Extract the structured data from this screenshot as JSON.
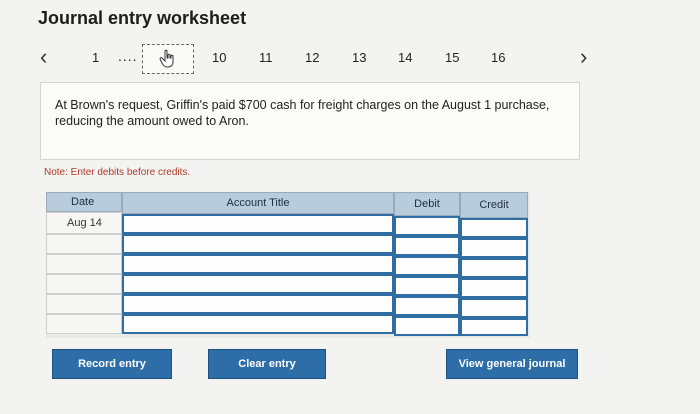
{
  "title": "Journal entry worksheet",
  "pager": {
    "first_page": "1",
    "ellipsis": "....",
    "pages": [
      "10",
      "11",
      "12",
      "13",
      "14",
      "15",
      "16"
    ]
  },
  "question": "At Brown's request, Griffin's paid $700 cash for freight charges on the August 1 purchase, reducing the amount owed to Aron.",
  "note": "Note: Enter debits before credits.",
  "table": {
    "headers": {
      "date": "Date",
      "account": "Account Title",
      "debit": "Debit",
      "credit": "Credit"
    },
    "rows": [
      {
        "date": "Aug 14"
      },
      {
        "date": ""
      },
      {
        "date": ""
      },
      {
        "date": ""
      },
      {
        "date": ""
      },
      {
        "date": ""
      }
    ]
  },
  "buttons": {
    "record": "Record entry",
    "clear": "Clear entry",
    "view": "View general journal"
  },
  "colors": {
    "header_bg": "#b9ccdc",
    "button_bg": "#2e6ea8",
    "note": "#b33a2a"
  }
}
